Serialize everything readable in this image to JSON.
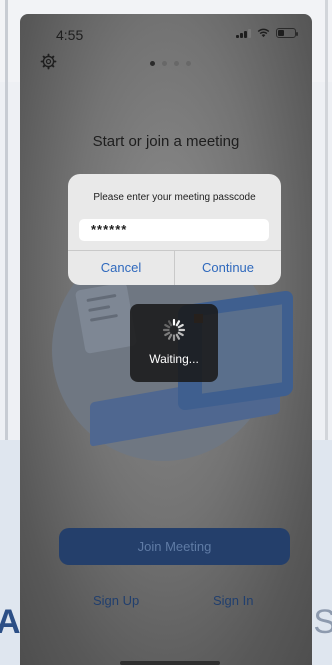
{
  "status_bar": {
    "time": "4:55"
  },
  "pager": {
    "pages": 4,
    "active": 0
  },
  "main": {
    "headline": "Start or join a meeting"
  },
  "dialog": {
    "message": "Please enter your meeting passcode",
    "passcode_value": "******",
    "cancel_label": "Cancel",
    "continue_label": "Continue"
  },
  "overlay": {
    "waiting_label": "Waiting..."
  },
  "actions": {
    "join_label": "Join Meeting",
    "sign_up_label": "Sign Up",
    "sign_in_label": "Sign In"
  },
  "icons": {
    "settings": "gear-icon",
    "signal": "signal-icon",
    "wifi": "wifi-icon",
    "battery": "battery-icon",
    "spinner": "spinner-icon"
  },
  "colors": {
    "accent": "#2f69bd",
    "join_button": "#243f6b",
    "dialog_bg": "#e9e9e9",
    "overlay_bg": "#1a1a1a"
  },
  "background_page": {
    "left_text": "AR",
    "right_text": "S"
  }
}
